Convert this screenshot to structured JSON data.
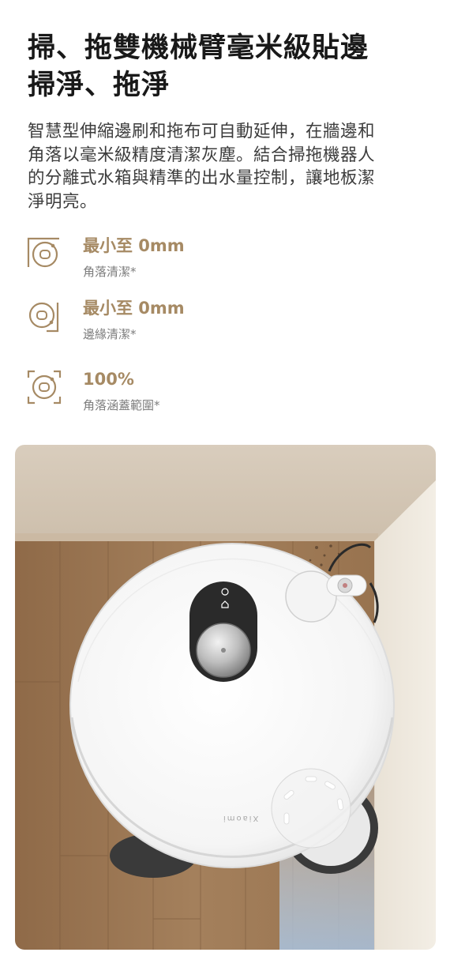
{
  "headline": {
    "line1": "掃、拖雙機械臂毫米級貼邊",
    "line2": "掃淨、拖淨"
  },
  "description": {
    "line1": "智慧型伸縮邊刷和拖布可自動延伸，在牆邊和",
    "line2": "角落以毫米級精度清潔灰塵。結合掃拖機器人",
    "line3": "的分離式水箱與精準的出水量控制，讓地板潔",
    "line4": "淨明亮。"
  },
  "features": [
    {
      "icon": "corner-cleaning-icon",
      "value": "最小至 0mm",
      "label": "角落清潔*"
    },
    {
      "icon": "edge-cleaning-icon",
      "value": "最小至 0mm",
      "label": "邊緣清潔*"
    },
    {
      "icon": "corner-coverage-icon",
      "value": "100%",
      "label": "角落涵蓋範圍*"
    }
  ],
  "product": {
    "brand": "Xiaomi"
  },
  "colors": {
    "accent": "#a68a64",
    "text": "#191919",
    "muted": "#7d7d7d"
  }
}
